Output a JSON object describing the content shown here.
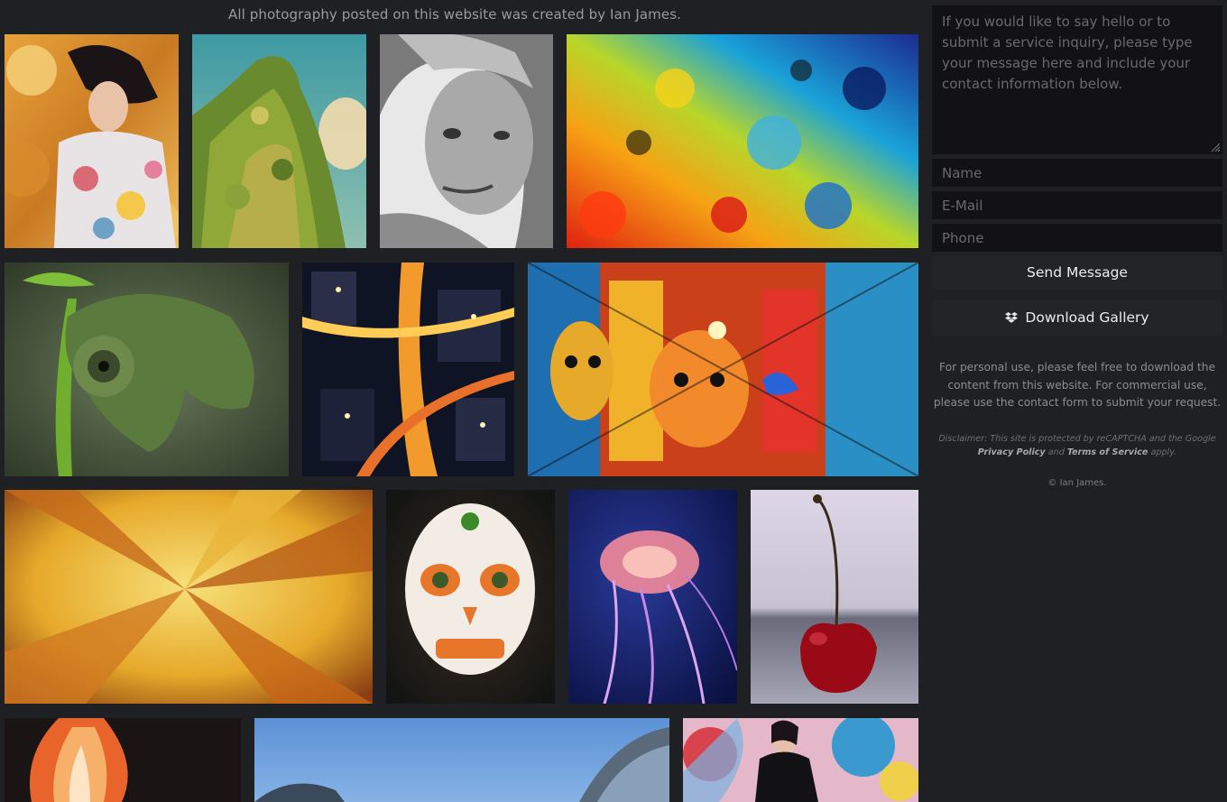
{
  "gallery": {
    "caption": "All photography posted on this website was created by Ian James.",
    "photos": [
      {
        "subject": "woman lying on floral fabric"
      },
      {
        "subject": "plant-covered tower against sky"
      },
      {
        "subject": "black and white freckled woman portrait"
      },
      {
        "subject": "colorful paint splatter abstract"
      },
      {
        "subject": "green chameleon close-up"
      },
      {
        "subject": "aerial city streets at night"
      },
      {
        "subject": "stained glass style street mural"
      },
      {
        "subject": "golden fractal architecture"
      },
      {
        "subject": "painted sugar skull"
      },
      {
        "subject": "pink jellyfish on blue"
      },
      {
        "subject": "red cherry on window sill"
      },
      {
        "subject": "fire flame on dark"
      },
      {
        "subject": "building dome against blue sky"
      },
      {
        "subject": "woman in front of graffiti wall"
      }
    ]
  },
  "contact_form": {
    "message_placeholder": "If you would like to say hello or to submit a service inquiry, please type your message here and include your contact information below.",
    "name_placeholder": "Name",
    "email_placeholder": "E-Mail",
    "phone_placeholder": "Phone",
    "send_label": "Send Message"
  },
  "download": {
    "label": "Download Gallery",
    "icon": "dropbox-icon"
  },
  "info_text": "For personal use, please feel free to download the content from this website. For commercial use, please use the contact form to submit your request.",
  "disclaimer": {
    "prefix": "Disclaimer: This site is protected by reCAPTCHA and the Google ",
    "privacy_link": "Privacy Policy",
    "middle": " and ",
    "terms_link": "Terms of Service",
    "suffix": " apply."
  },
  "copyright": "© Ian James.",
  "colors": {
    "background": "#1f2023",
    "field_background": "#121214",
    "button_background": "#232427"
  }
}
